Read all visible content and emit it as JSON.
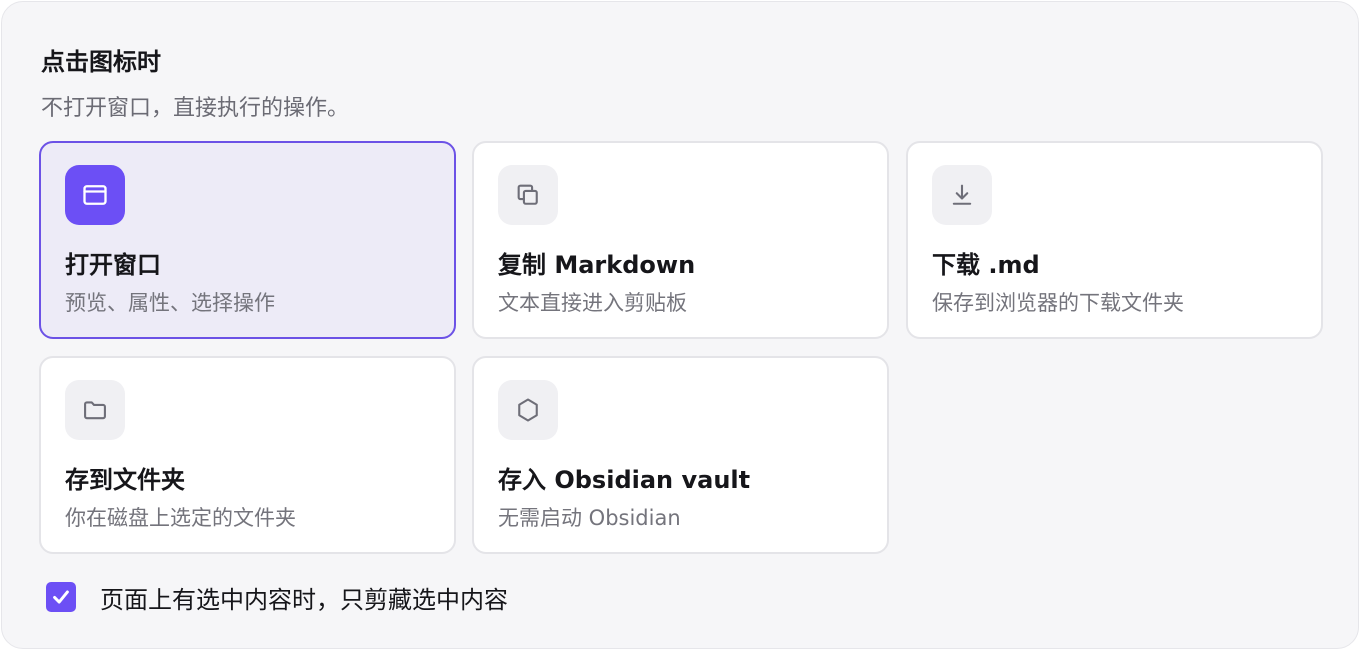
{
  "section": {
    "title": "点击图标时",
    "subtitle": "不打开窗口，直接执行的操作。"
  },
  "actions": [
    {
      "label": "打开窗口",
      "description": "预览、属性、选择操作",
      "icon": "window-icon",
      "selected": true
    },
    {
      "label": "复制 Markdown",
      "description": "文本直接进入剪贴板",
      "icon": "copy-icon",
      "selected": false
    },
    {
      "label": "下载 .md",
      "description": "保存到浏览器的下载文件夹",
      "icon": "download-icon",
      "selected": false
    },
    {
      "label": "存到文件夹",
      "description": "你在磁盘上选定的文件夹",
      "icon": "folder-icon",
      "selected": false
    },
    {
      "label": "存入 Obsidian vault",
      "description": "无需启动 Obsidian",
      "icon": "obsidian-icon",
      "selected": false
    }
  ],
  "selection_only": {
    "label": "页面上有选中内容时，只剪藏选中内容",
    "checked": true
  },
  "colors": {
    "accent": "#6c4ff5",
    "selected_card_bg": "#edebf7",
    "panel_bg": "#f6f6f8"
  }
}
